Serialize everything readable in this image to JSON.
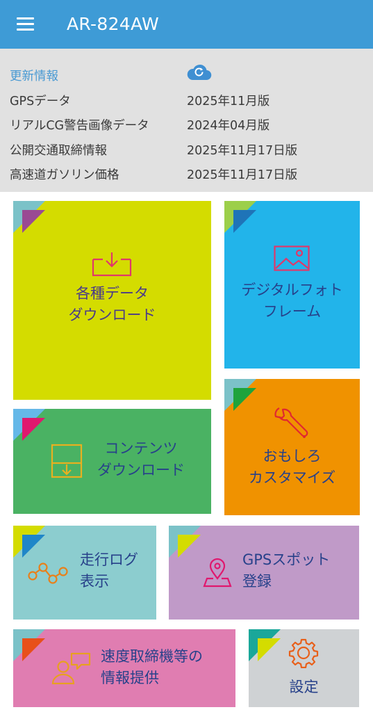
{
  "header": {
    "title": "AR-824AW"
  },
  "info": {
    "heading": "更新情報",
    "rows": [
      {
        "label": "GPSデータ",
        "value": "2025年11月版"
      },
      {
        "label": "リアルCG警告画像データ",
        "value": "2024年04月版"
      },
      {
        "label": "公開交通取締情報",
        "value": "2025年11月17日版"
      },
      {
        "label": "高速道ガソリン価格",
        "value": "2025年11月17日版"
      }
    ]
  },
  "tiles": {
    "data_download": {
      "line1": "各種データ",
      "line2": "ダウンロード",
      "color": "#d4dc00"
    },
    "photo_frame": {
      "line1": "デジタルフォト",
      "line2": "フレーム",
      "color": "#22b4ea"
    },
    "contents_download": {
      "line1": "コンテンツ",
      "line2": "ダウンロード",
      "color": "#4ab263"
    },
    "customize": {
      "line1": "おもしろ",
      "line2": "カスタマイズ",
      "color": "#f09200"
    },
    "drive_log": {
      "line1": "走行ログ",
      "line2": "表示",
      "color": "#8ccdcf"
    },
    "gps_spot": {
      "line1": "GPSスポット",
      "line2": "登録",
      "color": "#c09ac8"
    },
    "speed_trap": {
      "line1": "速度取締機等の",
      "line2": "情報提供",
      "color": "#e07db1"
    },
    "settings": {
      "line1": "設定",
      "color": "#cfd2d4"
    }
  }
}
